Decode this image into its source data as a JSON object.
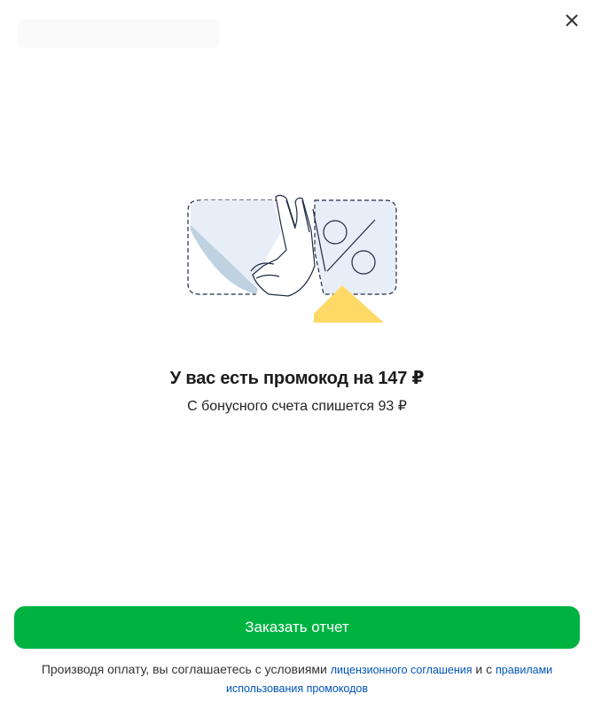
{
  "header": {
    "close_icon": "close-icon"
  },
  "illustration": {
    "icon": "promo-coupon-hand-illustration",
    "colors": {
      "coupon_fill": "#e8eef8",
      "coupon_stroke": "#1f2a44",
      "accent_yellow": "#ffd966"
    }
  },
  "promo": {
    "title": "У вас есть промокод на 147 ₽",
    "subtitle": "С бонусного счета спишется 93 ₽"
  },
  "actions": {
    "order_label": "Заказать отчет",
    "button_color": "#00b341"
  },
  "footer": {
    "agreement_prefix": "Производя оплату, вы соглашаетесь с условиями",
    "license_link": "лицензионного соглашения",
    "conjunction": "и с",
    "rules_link": "правилами использования промокодов"
  }
}
